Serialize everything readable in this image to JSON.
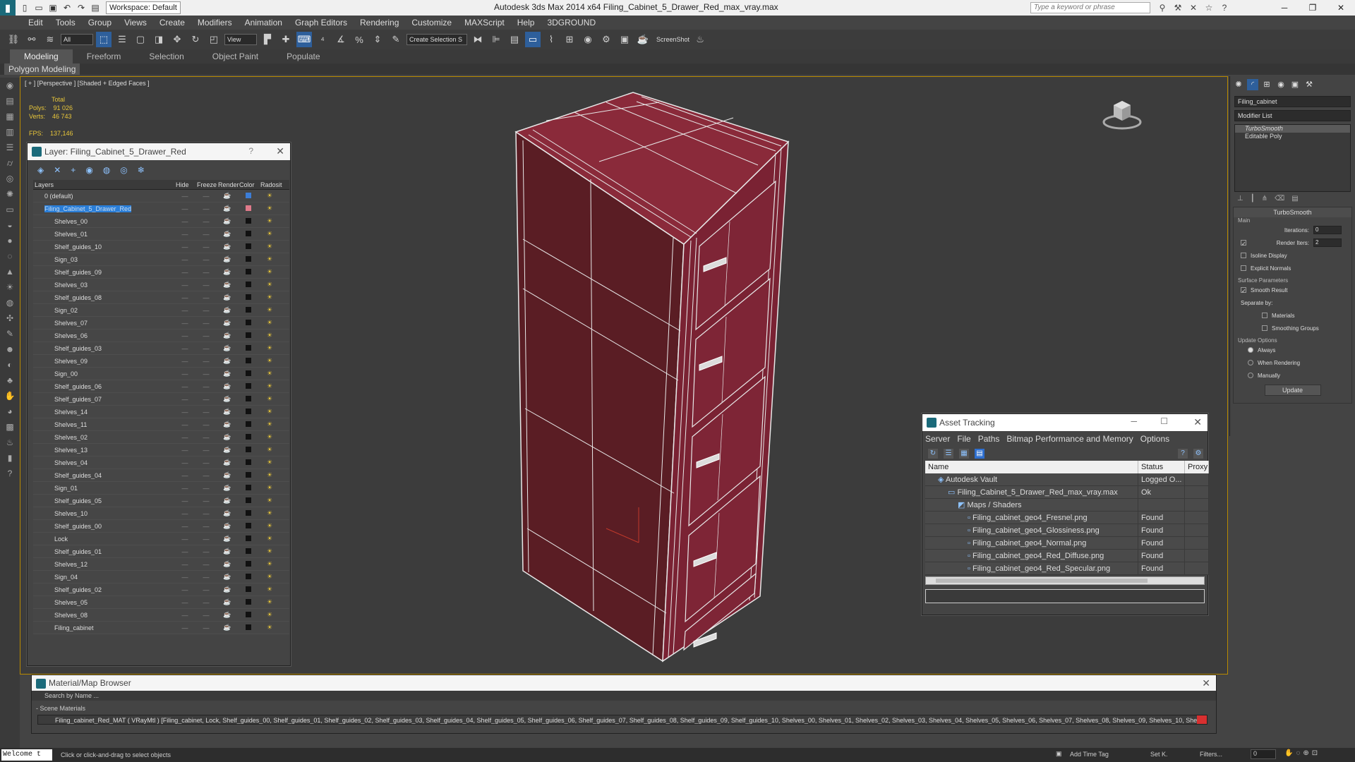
{
  "app": {
    "window_title": "Autodesk 3ds Max  2014 x64     Filing_Cabinet_5_Drawer_Red_max_vray.max",
    "workspace": "Workspace: Default",
    "search_placeholder": "Type a keyword or phrase"
  },
  "menu": [
    "Edit",
    "Tools",
    "Group",
    "Views",
    "Create",
    "Modifiers",
    "Animation",
    "Graph Editors",
    "Rendering",
    "Customize",
    "MAXScript",
    "Help",
    "3DGROUND"
  ],
  "toolbar": {
    "filter": "All",
    "ref_coord": "View",
    "selection_set": "Create Selection S",
    "screenshot_label": "ScreenShot"
  },
  "ribbon": {
    "tabs": [
      "Modeling",
      "Freeform",
      "Selection",
      "Object Paint",
      "Populate"
    ],
    "active_tab": "Modeling",
    "sub_label": "Polygon Modeling"
  },
  "viewport": {
    "label": "[ + ] [Perspective ] [Shaded + Edged Faces ]",
    "stats": {
      "total_label": "Total",
      "polys_label": "Polys:",
      "polys_value": "91 026",
      "verts_label": "Verts:",
      "verts_value": "46 743",
      "fps_label": "FPS:",
      "fps_value": "137,146"
    },
    "object_color": "#7a2233"
  },
  "layer_panel": {
    "title": "Layer: Filing_Cabinet_5_Drawer_Red",
    "help": "?",
    "columns": [
      "Layers",
      "Hide",
      "Freeze",
      "Render",
      "Color",
      "Radosit"
    ],
    "rows": [
      {
        "name": "0 (default)",
        "kind": "top",
        "color": "#3c7dd6"
      },
      {
        "name": "Filing_Cabinet_5_Drawer_Red",
        "kind": "top",
        "selected": true,
        "color": "#e07a8a"
      },
      {
        "name": "Shelves_00",
        "kind": "obj",
        "color": "#111111"
      },
      {
        "name": "Shelves_01",
        "kind": "obj",
        "color": "#111111"
      },
      {
        "name": "Shelf_guides_10",
        "kind": "obj",
        "color": "#111111"
      },
      {
        "name": "Sign_03",
        "kind": "obj",
        "color": "#111111"
      },
      {
        "name": "Shelf_guides_09",
        "kind": "obj",
        "color": "#111111"
      },
      {
        "name": "Shelves_03",
        "kind": "obj",
        "color": "#111111"
      },
      {
        "name": "Shelf_guides_08",
        "kind": "obj",
        "color": "#111111"
      },
      {
        "name": "Sign_02",
        "kind": "obj",
        "color": "#111111"
      },
      {
        "name": "Shelves_07",
        "kind": "obj",
        "color": "#111111"
      },
      {
        "name": "Shelves_06",
        "kind": "obj",
        "color": "#111111"
      },
      {
        "name": "Shelf_guides_03",
        "kind": "obj",
        "color": "#111111"
      },
      {
        "name": "Shelves_09",
        "kind": "obj",
        "color": "#111111"
      },
      {
        "name": "Sign_00",
        "kind": "obj",
        "color": "#111111"
      },
      {
        "name": "Shelf_guides_06",
        "kind": "obj",
        "color": "#111111"
      },
      {
        "name": "Shelf_guides_07",
        "kind": "obj",
        "color": "#111111"
      },
      {
        "name": "Shelves_14",
        "kind": "obj",
        "color": "#111111"
      },
      {
        "name": "Shelves_11",
        "kind": "obj",
        "color": "#111111"
      },
      {
        "name": "Shelves_02",
        "kind": "obj",
        "color": "#111111"
      },
      {
        "name": "Shelves_13",
        "kind": "obj",
        "color": "#111111"
      },
      {
        "name": "Shelves_04",
        "kind": "obj",
        "color": "#111111"
      },
      {
        "name": "Shelf_guides_04",
        "kind": "obj",
        "color": "#111111"
      },
      {
        "name": "Sign_01",
        "kind": "obj",
        "color": "#111111"
      },
      {
        "name": "Shelf_guides_05",
        "kind": "obj",
        "color": "#111111"
      },
      {
        "name": "Shelves_10",
        "kind": "obj",
        "color": "#111111"
      },
      {
        "name": "Shelf_guides_00",
        "kind": "obj",
        "color": "#111111"
      },
      {
        "name": "Lock",
        "kind": "obj",
        "color": "#111111"
      },
      {
        "name": "Shelf_guides_01",
        "kind": "obj",
        "color": "#111111"
      },
      {
        "name": "Shelves_12",
        "kind": "obj",
        "color": "#111111"
      },
      {
        "name": "Sign_04",
        "kind": "obj",
        "color": "#111111"
      },
      {
        "name": "Shelf_guides_02",
        "kind": "obj",
        "color": "#111111"
      },
      {
        "name": "Shelves_05",
        "kind": "obj",
        "color": "#111111"
      },
      {
        "name": "Shelves_08",
        "kind": "obj",
        "color": "#111111"
      },
      {
        "name": "Filing_cabinet",
        "kind": "obj",
        "color": "#111111"
      }
    ]
  },
  "asset_tracking": {
    "title": "Asset Tracking",
    "menu": [
      "Server",
      "File",
      "Paths",
      "Bitmap Performance and Memory",
      "Options"
    ],
    "columns": [
      "Name",
      "Status",
      "Proxy"
    ],
    "rows": [
      {
        "name": "Autodesk Vault",
        "status": "Logged O...",
        "proxy": "",
        "indent": 1
      },
      {
        "name": "Filing_Cabinet_5_Drawer_Red_max_vray.max",
        "status": "Ok",
        "proxy": "",
        "indent": 2
      },
      {
        "name": "Maps / Shaders",
        "status": "",
        "proxy": "",
        "indent": 3
      },
      {
        "name": "Filing_cabinet_geo4_Fresnel.png",
        "status": "Found",
        "proxy": "",
        "indent": 4
      },
      {
        "name": "Filing_cabinet_geo4_Glossiness.png",
        "status": "Found",
        "proxy": "",
        "indent": 4
      },
      {
        "name": "Filing_cabinet_geo4_Normal.png",
        "status": "Found",
        "proxy": "",
        "indent": 4
      },
      {
        "name": "Filing_cabinet_geo4_Red_Diffuse.png",
        "status": "Found",
        "proxy": "",
        "indent": 4
      },
      {
        "name": "Filing_cabinet_geo4_Red_Specular.png",
        "status": "Found",
        "proxy": "",
        "indent": 4
      }
    ]
  },
  "command_panel": {
    "object_name": "Filing_cabinet",
    "modifier_list": "Modifier List",
    "stack": [
      "TurboSmooth",
      "Editable Poly"
    ],
    "turbosmooth": {
      "title": "TurboSmooth",
      "main": "Main",
      "iterations_label": "Iterations:",
      "iterations": "0",
      "render_iters_label": "Render Iters:",
      "render_iters": "2",
      "isoline": "Isoline Display",
      "explicit": "Explicit Normals",
      "surface": "Surface Parameters",
      "smooth_result": "Smooth Result",
      "separate_by": "Separate by:",
      "materials": "Materials",
      "smoothing_groups": "Smoothing Groups",
      "update_options": "Update Options",
      "always": "Always",
      "when_rendering": "When Rendering",
      "manually": "Manually",
      "update_button": "Update"
    }
  },
  "material_browser": {
    "title": "Material/Map Browser",
    "search": "Search by Name ...",
    "scene_materials": "- Scene Materials",
    "material_line": "Filing_cabinet_Red_MAT ( VRayMtl ) [Filing_cabinet, Lock, Shelf_guides_00, Shelf_guides_01, Shelf_guides_02, Shelf_guides_03, Shelf_guides_04, Shelf_guides_05, Shelf_guides_06, Shelf_guides_07, Shelf_guides_08, Shelf_guides_09, Shelf_guides_10, Shelves_00, Shelves_01, Shelves_02, Shelves_03, Shelves_04, Shelves_05, Shelves_06, Shelves_07, Shelves_08, Shelves_09, Shelves_10, Shelves_11, Shelves_12, Shelves_13,"
  },
  "status": {
    "welcome": "Welcome t",
    "message": "Click or click-and-drag to select objects",
    "add_time_tag": "Add Time Tag",
    "set_k": "Set K.",
    "filters": "Filters...",
    "frame": "0"
  }
}
